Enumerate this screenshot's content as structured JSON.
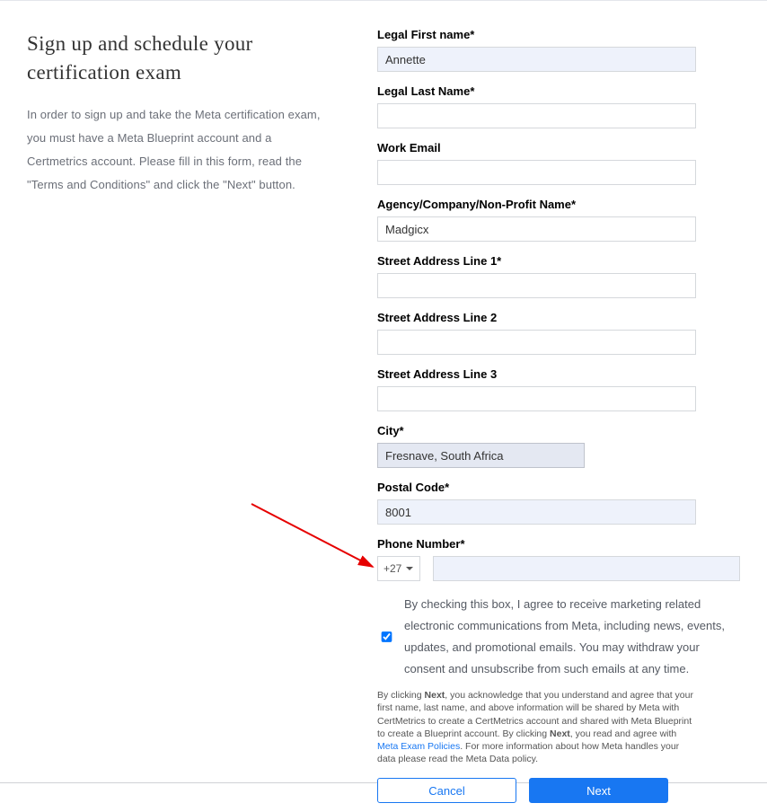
{
  "left": {
    "heading": "Sign up and schedule your certification exam",
    "intro": "In order to sign up and take the Meta certification exam, you must have a Meta Blueprint account and a Certmetrics account. Please fill in this form, read the \"Terms and Conditions\" and click the \"Next\" button."
  },
  "form": {
    "first_name_label": "Legal First name*",
    "first_name": "Annette",
    "last_name_label": "Legal Last Name*",
    "last_name": "",
    "email_label": "Work Email",
    "email": "",
    "company_label": "Agency/Company/Non-Profit Name*",
    "company": "Madgicx",
    "addr1_label": "Street Address Line 1*",
    "addr1": "",
    "addr2_label": "Street Address Line 2",
    "addr2": "",
    "addr3_label": "Street Address Line 3",
    "addr3": "",
    "city_label": "City*",
    "city": "Fresnave, South Africa",
    "postal_label": "Postal Code*",
    "postal": "8001",
    "phone_label": "Phone Number*",
    "dial_code": "+27",
    "phone": ""
  },
  "consent": {
    "text": "By checking this box, I agree to receive marketing related electronic communications from Meta, including news, events, updates, and promotional emails. You may withdraw your consent and unsubscribe from such emails at any time."
  },
  "legal": {
    "p1a": "By clicking ",
    "p1b": "Next",
    "p1c": ", you acknowledge that you understand and agree that your first name, last name, and above information will be shared by Meta with CertMetrics to create a CertMetrics account and shared with Meta Blueprint to create a Blueprint account. By clicking ",
    "p1d": "Next",
    "p1e": ", you read and agree with ",
    "link": "Meta Exam Policies",
    "p1f": ". For more information about how Meta handles your data please read the Meta Data policy."
  },
  "buttons": {
    "cancel": "Cancel",
    "next": "Next"
  }
}
